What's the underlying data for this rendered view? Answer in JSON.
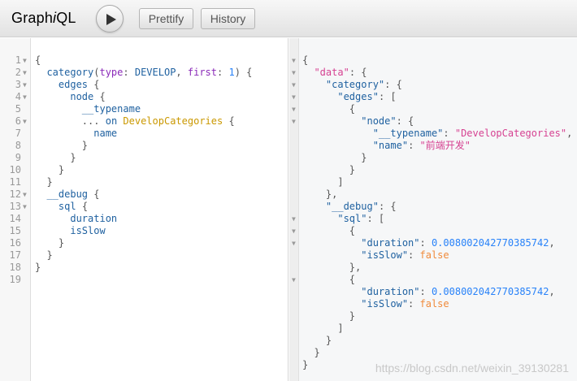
{
  "toolbar": {
    "title_prefix": "Graph",
    "title_italic": "i",
    "title_suffix": "QL",
    "execute_icon": "play-icon",
    "prettify_label": "Prettify",
    "history_label": "History"
  },
  "query_editor": {
    "lines": [
      {
        "n": "1",
        "fold": "▼"
      },
      {
        "n": "2",
        "fold": "▼"
      },
      {
        "n": "3",
        "fold": "▼"
      },
      {
        "n": "4",
        "fold": "▼"
      },
      {
        "n": "5",
        "fold": ""
      },
      {
        "n": "6",
        "fold": "▼"
      },
      {
        "n": "7",
        "fold": ""
      },
      {
        "n": "8",
        "fold": ""
      },
      {
        "n": "9",
        "fold": ""
      },
      {
        "n": "10",
        "fold": ""
      },
      {
        "n": "11",
        "fold": ""
      },
      {
        "n": "12",
        "fold": "▼"
      },
      {
        "n": "13",
        "fold": "▼"
      },
      {
        "n": "14",
        "fold": ""
      },
      {
        "n": "15",
        "fold": ""
      },
      {
        "n": "16",
        "fold": ""
      },
      {
        "n": "17",
        "fold": ""
      },
      {
        "n": "18",
        "fold": ""
      },
      {
        "n": "19",
        "fold": ""
      }
    ],
    "tokens": {
      "open": "{",
      "category": "category",
      "type_arg": "type",
      "type_val": "DEVELOP",
      "first_arg": "first",
      "first_val": "1",
      "edges": "edges",
      "node": "node",
      "typename": "__typename",
      "spread": "...",
      "on": "on",
      "fragment_type": "DevelopCategories",
      "name": "name",
      "debug": "__debug",
      "sql": "sql",
      "duration": "duration",
      "isSlow": "isSlow",
      "close": "}"
    }
  },
  "result_viewer": {
    "data_key": "\"data\"",
    "category_key": "\"category\"",
    "edges_key": "\"edges\"",
    "node_key": "\"node\"",
    "typename_key": "\"__typename\"",
    "typename_val": "\"DevelopCategories\"",
    "name_key": "\"name\"",
    "name_val": "\"前端开发\"",
    "debug_key": "\"__debug\"",
    "sql_key": "\"sql\"",
    "duration_key": "\"duration\"",
    "duration_val_1": "0.008002042770385742",
    "duration_val_2": "0.008002042770385742",
    "isSlow_key": "\"isSlow\"",
    "isSlow_val_1": "false",
    "isSlow_val_2": "false"
  },
  "watermark": "https://blog.csdn.net/weixin_39130281"
}
